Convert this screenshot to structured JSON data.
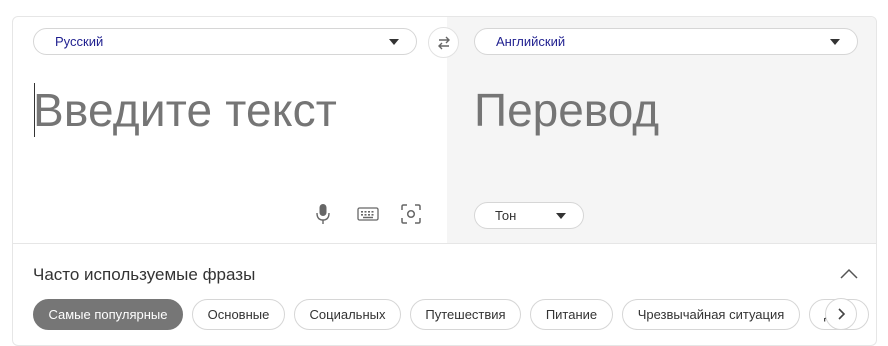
{
  "source_language": "Русский",
  "target_language": "Английский",
  "source_placeholder": "Введите текст",
  "target_placeholder": "Перевод",
  "tone_label": "Тон",
  "phrases": {
    "title": "Часто используемые фразы",
    "chips": [
      {
        "label": "Самые популярные",
        "active": true
      },
      {
        "label": "Основные",
        "active": false
      },
      {
        "label": "Социальных",
        "active": false
      },
      {
        "label": "Путешествия",
        "active": false
      },
      {
        "label": "Питание",
        "active": false
      },
      {
        "label": "Чрезвычайная ситуация",
        "active": false
      },
      {
        "label": "Д",
        "active": false
      }
    ]
  },
  "icons": {
    "swap": "swap-arrows-icon",
    "mic": "microphone-icon",
    "keyboard": "keyboard-icon",
    "camera": "camera-scan-icon",
    "collapse": "chevron-up-icon",
    "next": "chevron-right-icon"
  },
  "colors": {
    "language_text": "#1f1f8f",
    "active_chip": "#767676",
    "target_panel_bg": "#f5f5f5"
  }
}
